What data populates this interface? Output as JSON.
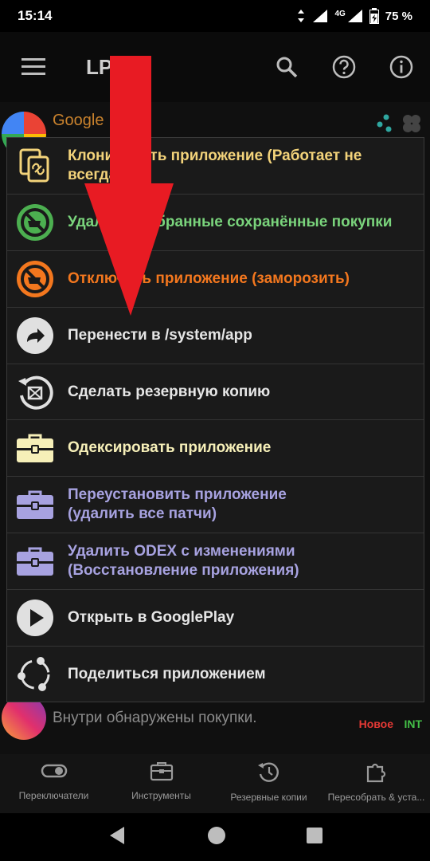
{
  "status_bar": {
    "time": "15:14",
    "network": "4G",
    "battery": "75 %"
  },
  "app_bar": {
    "title": "LP",
    "icons": [
      "menu-icon",
      "search-icon",
      "help-icon",
      "info-icon"
    ]
  },
  "background_list": {
    "rows": [
      {
        "title": "Google"
      },
      {
        "subtitle": "Внутри обнаружены покупки.",
        "badge_new": "Новое",
        "badge_int": "INT"
      }
    ]
  },
  "dialog": {
    "items": [
      {
        "icon": "clone-icon",
        "label": "Клонировать приложение (Работает не всегда)",
        "color": "#f3d37a"
      },
      {
        "icon": "remove-purchases-icon",
        "label": "Удалить выбранные сохранённые покупки",
        "color": "#7ad47c"
      },
      {
        "icon": "freeze-icon",
        "label": "Отключить приложение (заморозить)",
        "color": "#f3771e"
      },
      {
        "icon": "move-icon",
        "label": "Перенести в /system/app",
        "color": "#e6e6e6"
      },
      {
        "icon": "backup-icon",
        "label": "Сделать резервную копию",
        "color": "#e6e6e6"
      },
      {
        "icon": "toolbox-icon",
        "label": "Одексировать приложение",
        "color": "#f6efb8"
      },
      {
        "icon": "toolbox-icon",
        "label": "Переустановить приложение\n(удалить все патчи)",
        "color": "#a7a2e0"
      },
      {
        "icon": "toolbox-icon",
        "label": "Удалить ODEX с изменениями\n(Восстановление приложения)",
        "color": "#a7a2e0"
      },
      {
        "icon": "play-icon",
        "label": "Открыть в GooglePlay",
        "color": "#e6e6e6"
      },
      {
        "icon": "share-icon",
        "label": "Поделиться приложением",
        "color": "#e6e6e6"
      }
    ]
  },
  "bottom_nav": {
    "tabs": [
      {
        "icon": "toggle-icon",
        "label": "Переключатели"
      },
      {
        "icon": "toolbox-icon",
        "label": "Инструменты"
      },
      {
        "icon": "backup-icon",
        "label": "Резервные копии"
      },
      {
        "icon": "puzzle-icon",
        "label": "Пересобрать & уста..."
      }
    ]
  },
  "overlay": {
    "arrow_color": "#e81b23"
  }
}
